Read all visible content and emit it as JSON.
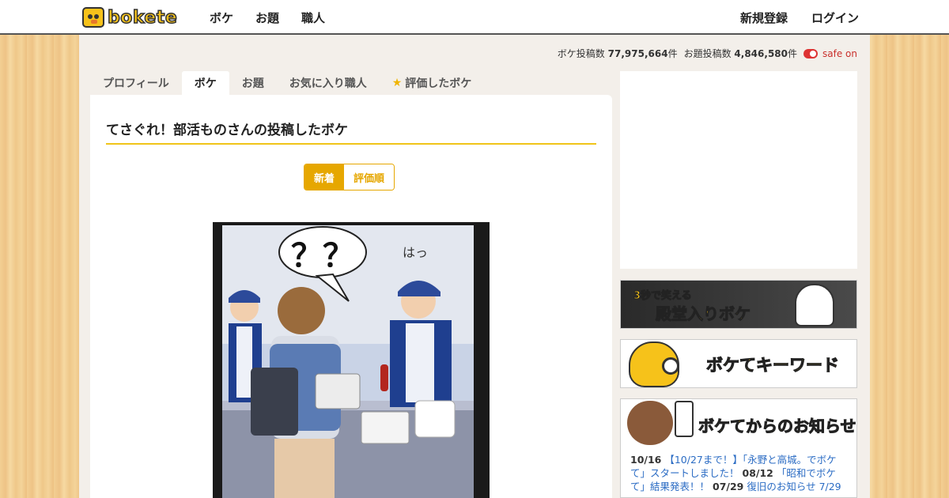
{
  "header": {
    "logo_text": "bokete",
    "nav_left": [
      "ボケ",
      "お題",
      "職人"
    ],
    "nav_right": [
      "新規登録",
      "ログイン"
    ]
  },
  "stats": {
    "boke_label": "ボケ投稿数",
    "boke_count": "77,975,664",
    "boke_unit": "件",
    "odai_label": "お題投稿数",
    "odai_count": "4,846,580",
    "odai_unit": "件",
    "safe_label": "safe on"
  },
  "tabs": [
    {
      "label": "プロフィール",
      "active": false
    },
    {
      "label": "ボケ",
      "active": true
    },
    {
      "label": "お題",
      "active": false
    },
    {
      "label": "お気に入り職人",
      "active": false
    },
    {
      "label": "評価したボケ",
      "active": false
    }
  ],
  "panel": {
    "title": "てさぐれ！部活ものさんの投稿したボケ",
    "sort_new": "新着",
    "sort_rated": "評価順"
  },
  "photo": {
    "speech_text": "？？",
    "side_text": "はっ"
  },
  "sidebar": {
    "banner1_small": "3秒で笑える",
    "banner1_main": "殿堂入りボケ",
    "banner2_main": "ボケてキーワード",
    "banner3_main": "ボケてからのお知らせ",
    "news": [
      {
        "date": "10/16",
        "text": "【10/27まで！】「永野と高城。でボケて」スタートしました！"
      },
      {
        "date": "08/12",
        "text": "「昭和でボケて」結果発表！！"
      },
      {
        "date": "07/29",
        "text": "復旧のお知らせ 7/29"
      }
    ]
  },
  "colors": {
    "accent": "#e6a700",
    "brand_yellow": "#f6c21a",
    "safe_red": "#c9302c",
    "link_blue": "#2b6cc4"
  }
}
